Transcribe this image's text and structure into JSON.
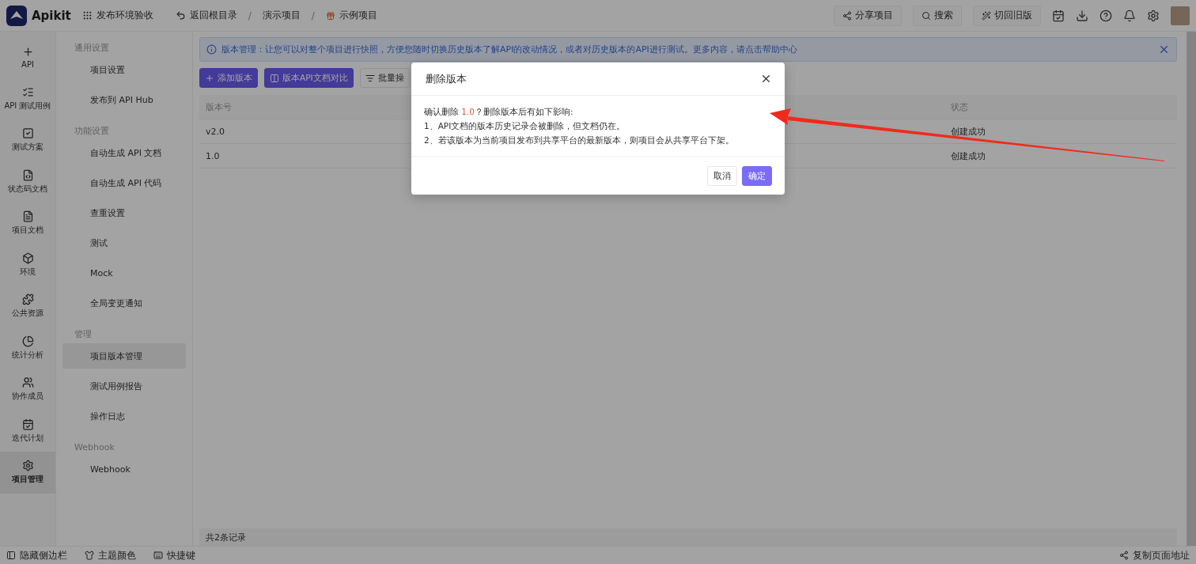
{
  "top_bar": {
    "logo_text": "Apikit",
    "workspace": "发布环境验收",
    "back": "返回根目录",
    "separator": "/",
    "breadcrumb": [
      "演示项目",
      "示例项目"
    ],
    "actions": [
      "分享项目",
      "搜索",
      "切回旧版"
    ]
  },
  "rail": [
    {
      "label": "API",
      "selected": false
    },
    {
      "label": "API 测试用例",
      "selected": false
    },
    {
      "label": "测试方案",
      "selected": false
    },
    {
      "label": "状态码文档",
      "selected": false
    },
    {
      "label": "项目文档",
      "selected": false
    },
    {
      "label": "环境",
      "selected": false
    },
    {
      "label": "公共资源",
      "selected": false
    },
    {
      "label": "统计分析",
      "selected": false
    },
    {
      "label": "协作成员",
      "selected": false
    },
    {
      "label": "迭代计划",
      "selected": false
    },
    {
      "label": "项目管理",
      "selected": true
    }
  ],
  "settings_nav": [
    {
      "title": "通用设置",
      "items": [
        {
          "label": "项目设置",
          "selected": false
        },
        {
          "label": "发布到 API Hub",
          "selected": false
        }
      ]
    },
    {
      "title": "功能设置",
      "items": [
        {
          "label": "自动生成 API 文档",
          "selected": false
        },
        {
          "label": "自动生成 API 代码",
          "selected": false
        },
        {
          "label": "查重设置",
          "selected": false
        },
        {
          "label": "测试",
          "selected": false
        },
        {
          "label": "Mock",
          "selected": false
        },
        {
          "label": "全局变更通知",
          "selected": false
        }
      ]
    },
    {
      "title": "管理",
      "items": [
        {
          "label": "项目版本管理",
          "selected": true
        },
        {
          "label": "测试用例报告",
          "selected": false
        },
        {
          "label": "操作日志",
          "selected": false
        }
      ]
    },
    {
      "title": "Webhook",
      "items": [
        {
          "label": "Webhook",
          "selected": false
        }
      ]
    }
  ],
  "notice": "版本管理：让您可以对整个项目进行快照，方便您随时切换历史版本了解API的改动情况，或者对历史版本的API进行测试。更多内容，请点击帮助中心",
  "toolbar": [
    {
      "label": "添加版本",
      "kind": "primary"
    },
    {
      "label": "版本API文档对比",
      "kind": "primary"
    },
    {
      "label": "批量操",
      "kind": "plain"
    }
  ],
  "table": {
    "columns": [
      "版本号",
      "状态"
    ],
    "rows": [
      {
        "version": "v2.0",
        "status": "创建成功"
      },
      {
        "version": "1.0",
        "status": "创建成功"
      }
    ],
    "footer": "共2条记录"
  },
  "bottom_bar": {
    "left": [
      "隐藏侧边栏",
      "主题颜色",
      "快捷键"
    ],
    "right": "复制页面地址"
  },
  "modal": {
    "title": "删除版本",
    "confirm_prefix": "确认删除",
    "target": "1.0",
    "confirm_suffix": "？删除版本后有如下影响:",
    "lines": [
      "1、API文档的版本历史记录会被删除，但文档仍在。",
      "2、若该版本为当前项目发布到共享平台的最新版本，则项目会从共享平台下架。"
    ],
    "cancel": "取消",
    "ok": "确定"
  }
}
